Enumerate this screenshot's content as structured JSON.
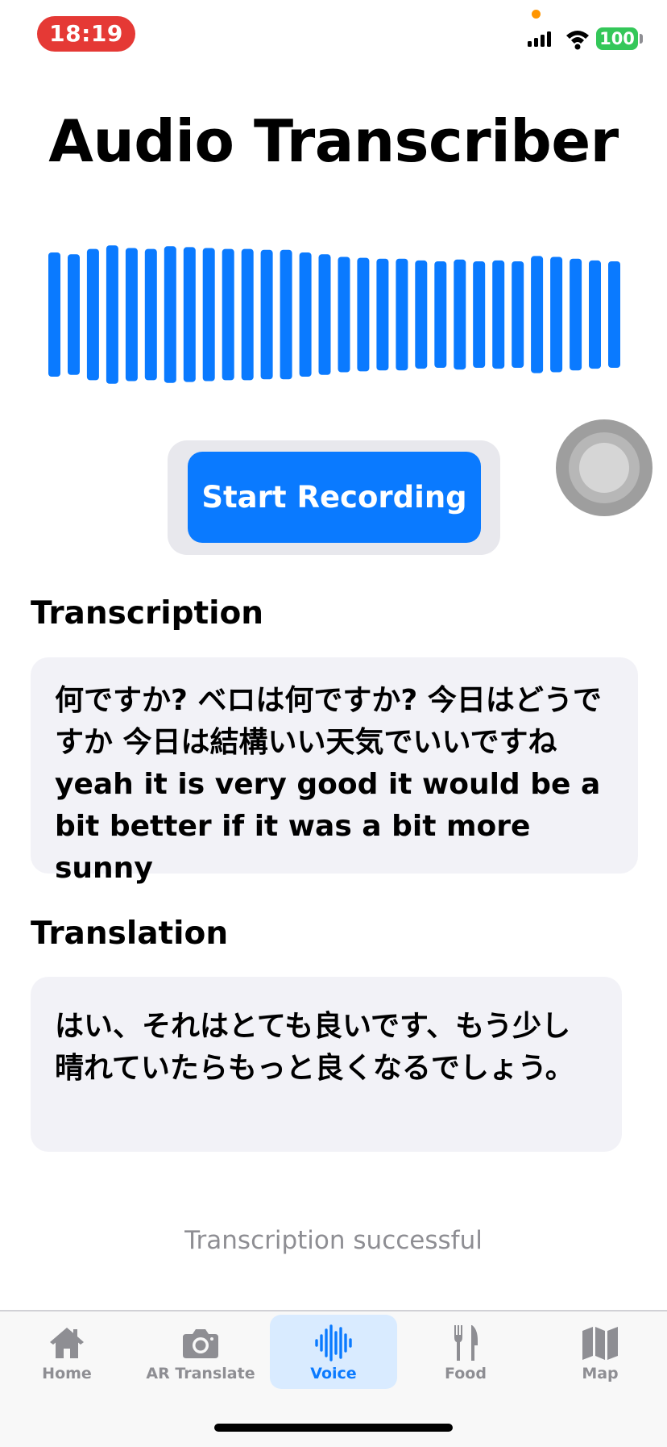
{
  "status_bar": {
    "time": "18:19",
    "battery": "100"
  },
  "title": "Audio Transcriber",
  "waveform": {
    "color": "#0A7AFF",
    "levels": [
      0.7,
      0.68,
      0.74,
      0.78,
      0.75,
      0.74,
      0.77,
      0.76,
      0.75,
      0.74,
      0.74,
      0.73,
      0.73,
      0.7,
      0.68,
      0.65,
      0.64,
      0.63,
      0.63,
      0.61,
      0.6,
      0.62,
      0.6,
      0.61,
      0.6,
      0.66,
      0.65,
      0.63,
      0.61,
      0.6
    ]
  },
  "record_button": {
    "label": "Start Recording"
  },
  "transcription": {
    "heading": "Transcription",
    "text": "何ですか? ベロは何ですか? 今日はどうですか 今日は結構いい天気でいいですね yeah it is very good it would be a bit better if it was a bit more sunny"
  },
  "translation": {
    "heading": "Translation",
    "text": "はい、それはとても良いです、もう少し晴れていたらもっと良くなるでしょう。"
  },
  "status_message": "Transcription successful",
  "tab_bar": {
    "items": [
      {
        "label": "Home",
        "icon": "house-icon",
        "active": false
      },
      {
        "label": "AR Translate",
        "icon": "camera-icon",
        "active": false
      },
      {
        "label": "Voice",
        "icon": "waveform-icon",
        "active": true
      },
      {
        "label": "Food",
        "icon": "fork-knife-icon",
        "active": false
      },
      {
        "label": "Map",
        "icon": "map-icon",
        "active": false
      }
    ]
  },
  "colors": {
    "accent": "#0A7AFF",
    "time_pill": "#E53935",
    "battery": "#34C759",
    "card_background": "#F2F2F7"
  }
}
